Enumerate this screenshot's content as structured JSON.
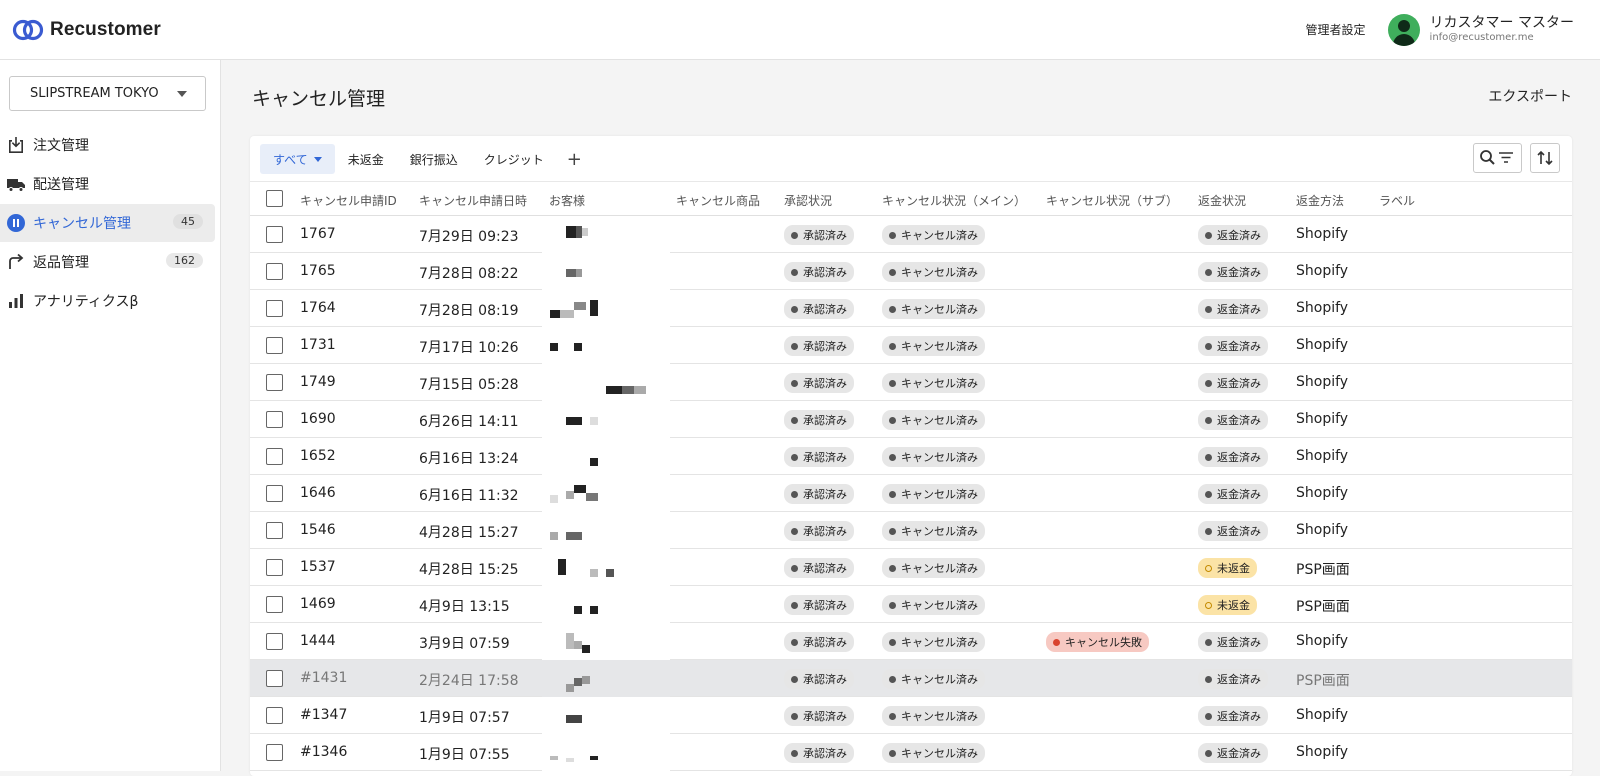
{
  "app": {
    "logo_text": "Recustomer",
    "admin_settings": "管理者設定",
    "user_name": "リカスタマー マスター",
    "user_email": "info@recustomer.me"
  },
  "sidebar": {
    "store": "SLIPSTREAM TOKYO",
    "items": [
      {
        "label": "注文管理",
        "icon": "order-icon",
        "badge": ""
      },
      {
        "label": "配送管理",
        "icon": "truck-icon",
        "badge": ""
      },
      {
        "label": "キャンセル管理",
        "icon": "cancel-icon",
        "badge": "45",
        "active": true
      },
      {
        "label": "返品管理",
        "icon": "return-icon",
        "badge": "162"
      },
      {
        "label": "アナリティクスβ",
        "icon": "chart-icon",
        "badge": ""
      }
    ]
  },
  "main": {
    "title": "キャンセル管理",
    "export_label": "エクスポート",
    "tabs": [
      "すべて",
      "未返金",
      "銀行振込",
      "クレジット"
    ],
    "columns": [
      "キャンセル申請ID",
      "キャンセル申請日時",
      "お客様",
      "キャンセル商品",
      "承認状況",
      "キャンセル状況（メイン）",
      "キャンセル状況（サブ）",
      "返金状況",
      "返金方法",
      "ラベル"
    ]
  },
  "rows": [
    {
      "id": "1767",
      "date": "7月29日 09:23",
      "approval": "承認済み",
      "main_status": "キャンセル済み",
      "sub_status": "",
      "refund_status": "返金済み",
      "refund_kind": "done",
      "method": "Shopify"
    },
    {
      "id": "1765",
      "date": "7月28日 08:22",
      "approval": "承認済み",
      "main_status": "キャンセル済み",
      "sub_status": "",
      "refund_status": "返金済み",
      "refund_kind": "done",
      "method": "Shopify"
    },
    {
      "id": "1764",
      "date": "7月28日 08:19",
      "approval": "承認済み",
      "main_status": "キャンセル済み",
      "sub_status": "",
      "refund_status": "返金済み",
      "refund_kind": "done",
      "method": "Shopify"
    },
    {
      "id": "1731",
      "date": "7月17日 10:26",
      "approval": "承認済み",
      "main_status": "キャンセル済み",
      "sub_status": "",
      "refund_status": "返金済み",
      "refund_kind": "done",
      "method": "Shopify"
    },
    {
      "id": "1749",
      "date": "7月15日 05:28",
      "approval": "承認済み",
      "main_status": "キャンセル済み",
      "sub_status": "",
      "refund_status": "返金済み",
      "refund_kind": "done",
      "method": "Shopify"
    },
    {
      "id": "1690",
      "date": "6月26日 14:11",
      "approval": "承認済み",
      "main_status": "キャンセル済み",
      "sub_status": "",
      "refund_status": "返金済み",
      "refund_kind": "done",
      "method": "Shopify"
    },
    {
      "id": "1652",
      "date": "6月16日 13:24",
      "approval": "承認済み",
      "main_status": "キャンセル済み",
      "sub_status": "",
      "refund_status": "返金済み",
      "refund_kind": "done",
      "method": "Shopify"
    },
    {
      "id": "1646",
      "date": "6月16日 11:32",
      "approval": "承認済み",
      "main_status": "キャンセル済み",
      "sub_status": "",
      "refund_status": "返金済み",
      "refund_kind": "done",
      "method": "Shopify"
    },
    {
      "id": "1546",
      "date": "4月28日 15:27",
      "approval": "承認済み",
      "main_status": "キャンセル済み",
      "sub_status": "",
      "refund_status": "返金済み",
      "refund_kind": "done",
      "method": "Shopify"
    },
    {
      "id": "1537",
      "date": "4月28日 15:25",
      "approval": "承認済み",
      "main_status": "キャンセル済み",
      "sub_status": "",
      "refund_status": "未返金",
      "refund_kind": "pending",
      "method": "PSP画面"
    },
    {
      "id": "1469",
      "date": "4月9日 13:15",
      "approval": "承認済み",
      "main_status": "キャンセル済み",
      "sub_status": "",
      "refund_status": "未返金",
      "refund_kind": "pending",
      "method": "PSP画面"
    },
    {
      "id": "1444",
      "date": "3月9日 07:59",
      "approval": "承認済み",
      "main_status": "キャンセル済み",
      "sub_status": "キャンセル失敗",
      "refund_status": "返金済み",
      "refund_kind": "done",
      "method": "Shopify"
    },
    {
      "id": "#1431",
      "date": "2月24日 17:58",
      "approval": "承認済み",
      "main_status": "キャンセル済み",
      "sub_status": "",
      "refund_status": "返金済み",
      "refund_kind": "done",
      "method": "PSP画面",
      "highlight": true
    },
    {
      "id": "#1347",
      "date": "1月9日 07:57",
      "approval": "承認済み",
      "main_status": "キャンセル済み",
      "sub_status": "",
      "refund_status": "返金済み",
      "refund_kind": "done",
      "method": "Shopify"
    },
    {
      "id": "#1346",
      "date": "1月9日 07:55",
      "approval": "承認済み",
      "main_status": "キャンセル済み",
      "sub_status": "",
      "refund_status": "返金済み",
      "refund_kind": "done",
      "method": "Shopify"
    }
  ]
}
